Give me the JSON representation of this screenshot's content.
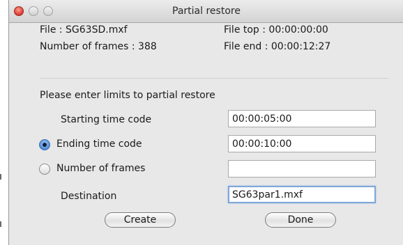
{
  "window": {
    "title": "Partial restore"
  },
  "info": {
    "file": "File : SG63SD.mxf",
    "frames": "Number of frames : 388",
    "file_top": "File top  : 00:00:00:00",
    "file_end": "File end : 00:00:12:27"
  },
  "prompt": "Please enter limits to partial restore",
  "rows": {
    "starting": {
      "label": "Starting time code",
      "value": "00:00:05:00"
    },
    "ending": {
      "label": "Ending time code",
      "value": "00:00:10:00",
      "selected": true
    },
    "frames": {
      "label": "Number of frames",
      "value": "",
      "selected": false
    },
    "destination": {
      "label": "Destination",
      "value": "SG63par1.mxf"
    }
  },
  "buttons": {
    "create": "Create",
    "done": "Done"
  },
  "colors": {
    "window_bg": "#e8e8e8",
    "close_button": "#e0443a",
    "focus_ring": "#7fa6d9",
    "radio_selected": "#4f8ad6"
  }
}
